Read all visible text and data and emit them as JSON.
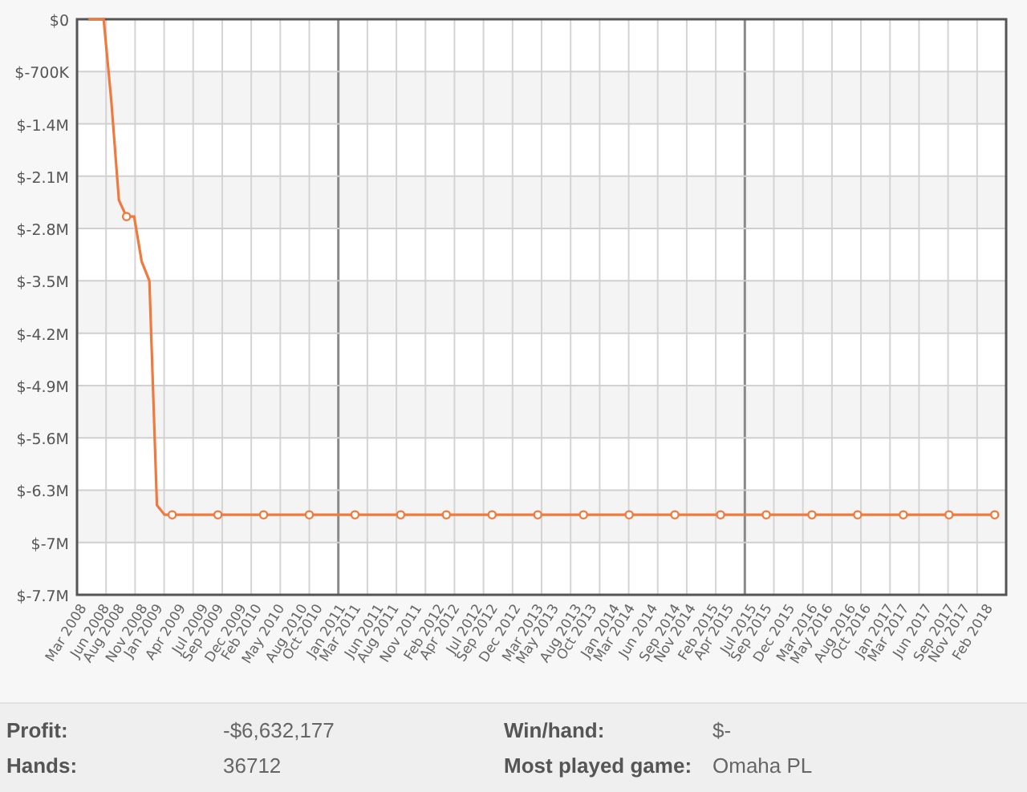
{
  "chart": {
    "chart_data": {
      "type": "line",
      "categories": [
        "Mar 2008",
        null,
        null,
        "Jun 2008",
        null,
        "Aug 2008",
        null,
        null,
        "Nov 2008",
        null,
        "Jan 2009",
        null,
        null,
        "Apr 2009",
        null,
        null,
        "Jul 2009",
        null,
        "Sep 2009",
        null,
        null,
        "Dec 2009",
        null,
        "Feb 2010",
        null,
        null,
        "May 2010",
        null,
        null,
        "Aug 2010",
        null,
        "Oct 2010",
        null,
        null,
        "Jan 2011",
        null,
        "Mar 2011",
        null,
        null,
        "Jun 2011",
        null,
        "Aug 2011",
        null,
        null,
        "Nov 2011",
        null,
        null,
        "Feb 2012",
        null,
        "Apr 2012",
        null,
        null,
        "Jul 2012",
        null,
        "Sep 2012",
        null,
        null,
        "Dec 2012",
        null,
        null,
        "Mar 2013",
        null,
        "May 2013",
        null,
        null,
        "Aug 2013",
        null,
        "Oct 2013",
        null,
        null,
        "Jan 2014",
        null,
        "Mar 2014",
        null,
        null,
        "Jun 2014",
        null,
        null,
        "Sep 2014",
        null,
        "Nov 2014",
        null,
        null,
        "Feb 2015",
        null,
        "Apr 2015",
        null,
        null,
        "Jul 2015",
        null,
        "Sep 2015",
        null,
        null,
        "Dec 2015",
        null,
        null,
        "Mar 2016",
        null,
        "May 2016",
        null,
        null,
        "Aug 2016",
        null,
        "Oct 2016",
        null,
        null,
        "Jan 2017",
        null,
        "Mar 2017",
        null,
        null,
        "Jun 2017",
        null,
        null,
        "Sep 2017",
        null,
        "Nov 2017",
        null,
        null,
        "Feb 2018"
      ],
      "series": [
        {
          "color": "#f07a3e",
          "values": [
            0,
            0,
            0,
            -1100000,
            -2420000,
            -2640000,
            -2640000,
            -3240000,
            -3500000,
            -6500000,
            -6630000,
            -6630000,
            -6630000,
            -6630000,
            -6630000,
            -6630000,
            -6630000,
            -6630000,
            -6630000,
            -6630000,
            -6630000,
            -6630000,
            -6630000,
            -6630000,
            -6630000,
            -6630000,
            -6630000,
            -6630000,
            -6630000,
            -6630000,
            -6630000,
            -6630000,
            -6630000,
            -6630000,
            -6630000,
            -6630000,
            -6630000,
            -6630000,
            -6630000,
            -6630000,
            -6630000,
            -6630000,
            -6630000,
            -6630000,
            -6630000,
            -6630000,
            -6630000,
            -6630000,
            -6630000,
            -6630000,
            -6630000,
            -6630000,
            -6630000,
            -6630000,
            -6630000,
            -6630000,
            -6630000,
            -6630000,
            -6630000,
            -6630000,
            -6630000,
            -6630000,
            -6630000,
            -6630000,
            -6630000,
            -6630000,
            -6630000,
            -6630000,
            -6630000,
            -6630000,
            -6630000,
            -6630000,
            -6630000,
            -6630000,
            -6630000,
            -6630000,
            -6630000,
            -6630000,
            -6630000,
            -6630000,
            -6630000,
            -6630000,
            -6630000,
            -6630000,
            -6630000,
            -6630000,
            -6630000,
            -6630000,
            -6630000,
            -6630000,
            -6630000,
            -6630000,
            -6630000,
            -6630000,
            -6630000,
            -6630000,
            -6630000,
            -6630000,
            -6630000,
            -6630000,
            -6630000,
            -6630000,
            -6630000,
            -6630000,
            -6630000,
            -6630000,
            -6630000,
            -6630000,
            -6630000,
            -6630000,
            -6630000,
            -6630000,
            -6630000,
            -6630000,
            -6630000,
            -6630000,
            -6630000,
            -6630000,
            -6630000,
            -6630000
          ]
        }
      ],
      "ylim": [
        -7700000,
        0
      ],
      "grid": true,
      "yticks": [
        {
          "value": 0,
          "label": "$0"
        },
        {
          "value": -700000,
          "label": "$-700K"
        },
        {
          "value": -1400000,
          "label": "$-1.4M"
        },
        {
          "value": -2100000,
          "label": "$-2.1M"
        },
        {
          "value": -2800000,
          "label": "$-2.8M"
        },
        {
          "value": -3500000,
          "label": "$-3.5M"
        },
        {
          "value": -4200000,
          "label": "$-4.2M"
        },
        {
          "value": -4900000,
          "label": "$-4.9M"
        },
        {
          "value": -5600000,
          "label": "$-5.6M"
        },
        {
          "value": -6300000,
          "label": "$-6.3M"
        },
        {
          "value": -7000000,
          "label": "$-7M"
        },
        {
          "value": -7700000,
          "label": "$-7.7M"
        }
      ]
    }
  },
  "stats": [
    {
      "label": "Profit:",
      "value": "-$6,632,177"
    },
    {
      "label": "Win/hand:",
      "value": "$-"
    },
    {
      "label": "Hands:",
      "value": "36712"
    },
    {
      "label": "Most played game:",
      "value": "Omaha PL"
    }
  ]
}
